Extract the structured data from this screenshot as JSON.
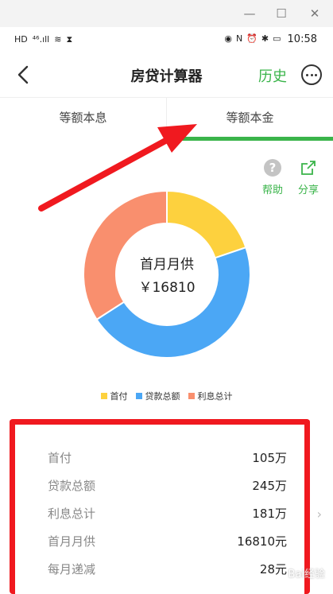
{
  "window": {
    "minimize": "—",
    "maximize": "☐",
    "close": "✕"
  },
  "statusbar": {
    "left": [
      "HD",
      "⁴⁶.ıll",
      "≋",
      "⧗"
    ],
    "right": [
      "◉",
      "N",
      "⏰",
      "✱",
      "▭"
    ],
    "time": "10:58"
  },
  "nav": {
    "title": "房贷计算器",
    "history": "历史"
  },
  "tabs": [
    {
      "label": "等额本息"
    },
    {
      "label": "等额本金",
      "active": true
    }
  ],
  "actions": {
    "help_label": "帮助",
    "share_label": "分享"
  },
  "donut": {
    "center_label": "首月月供",
    "center_value": "￥16810"
  },
  "chart_data": {
    "type": "pie",
    "categories": [
      "首付",
      "贷款总额",
      "利息总计"
    ],
    "values": [
      105,
      245,
      181
    ],
    "colors": [
      "#FDD13E",
      "#4BA7F5",
      "#F98F6E"
    ]
  },
  "legend": [
    {
      "label": "首付",
      "color": "#FDD13E"
    },
    {
      "label": "贷款总额",
      "color": "#4BA7F5"
    },
    {
      "label": "利息总计",
      "color": "#F98F6E"
    }
  ],
  "summary": [
    {
      "label": "首付",
      "value": "105万"
    },
    {
      "label": "贷款总额",
      "value": "245万"
    },
    {
      "label": "利息总计",
      "value": "181万"
    },
    {
      "label": "首月月供",
      "value": "16810元"
    },
    {
      "label": "每月递减",
      "value": "28元"
    }
  ],
  "watermark": "Bai经验"
}
